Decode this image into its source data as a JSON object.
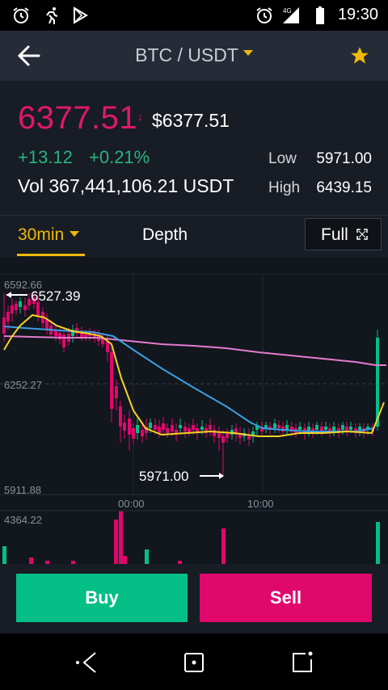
{
  "status_bar": {
    "time": "19:30",
    "network": "4G"
  },
  "header": {
    "title": "BTC / USDT"
  },
  "ticker": {
    "price": "6377.51",
    "price_usd": "$6377.51",
    "change": "+13.12",
    "change_pct": "+0.21%",
    "volume": "Vol 367,441,106.21 USDT",
    "low_label": "Low",
    "low_value": "5971.00",
    "high_label": "High",
    "high_value": "6439.15"
  },
  "tabs": {
    "interval": "30min",
    "depth": "Depth",
    "full": "Full"
  },
  "chart": {
    "price_axis": [
      "6592.66",
      "6252.27",
      "5911.88"
    ],
    "time_axis": [
      "00:00",
      "10:00"
    ],
    "volume_axis": "4364.22",
    "max_marker": "6527.39",
    "min_marker": "5971.00"
  },
  "actions": {
    "buy": "Buy",
    "sell": "Sell"
  },
  "colors": {
    "up": "#03bf85",
    "down": "#e0076d",
    "accent": "#f0b90b",
    "ma_short": "#f5d225",
    "ma_mid": "#3a9ee3",
    "ma_long": "#e37cd0"
  }
}
